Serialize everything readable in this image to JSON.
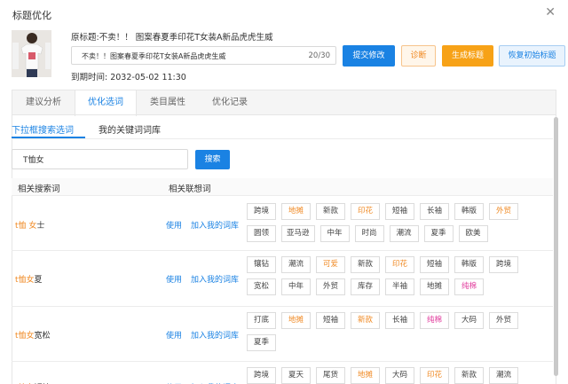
{
  "dialog": {
    "title": "标题优化",
    "close_icon": "close-icon"
  },
  "product": {
    "original_title": "原标题:不卖！！ 图案春夏季印花T女装A新品虎虎生威",
    "title_value": "不卖！！图案春夏季印花T女装A新品虎虎生威",
    "char_count": "20/30",
    "expire": "到期时间: 2032-05-02 11:30"
  },
  "buttons": {
    "submit": "提交修改",
    "diagnose": "诊断",
    "generate": "生成标题",
    "restore": "恢复初始标题"
  },
  "tabs": [
    "建议分析",
    "优化选词",
    "类目属性",
    "优化记录"
  ],
  "subtabs": [
    "下拉框搜索选词",
    "我的关键词词库"
  ],
  "search": {
    "value": "T恤女",
    "button": "搜索"
  },
  "table": {
    "headers": [
      "相关搜索词",
      "相关联想词"
    ],
    "use_label": "使用",
    "add_label": "加入我的词库",
    "rows": [
      {
        "kw_hl": "t恤 女",
        "kw_rest": "士",
        "tags": [
          [
            "跨境",
            ""
          ],
          [
            "地摊",
            "hot"
          ],
          [
            "新款",
            ""
          ],
          [
            "印花",
            "hot"
          ],
          [
            "短袖",
            ""
          ],
          [
            "长袖",
            ""
          ],
          [
            "韩版",
            ""
          ],
          [
            "外贸",
            "hot"
          ],
          [
            "圆领",
            ""
          ],
          [
            "亚马逊",
            ""
          ],
          [
            "中年",
            ""
          ],
          [
            "时尚",
            ""
          ],
          [
            "潮流",
            ""
          ],
          [
            "夏季",
            ""
          ],
          [
            "欧美",
            ""
          ]
        ]
      },
      {
        "kw_hl": "t恤女",
        "kw_rest": "夏",
        "tags": [
          [
            "镶钻",
            ""
          ],
          [
            "潮流",
            ""
          ],
          [
            "可爱",
            "hot"
          ],
          [
            "新款",
            ""
          ],
          [
            "印花",
            "hot"
          ],
          [
            "短袖",
            ""
          ],
          [
            "韩版",
            ""
          ],
          [
            "跨境",
            ""
          ],
          [
            "宽松",
            ""
          ],
          [
            "中年",
            ""
          ],
          [
            "外贸",
            ""
          ],
          [
            "库存",
            ""
          ],
          [
            "半袖",
            ""
          ],
          [
            "地摊",
            ""
          ],
          [
            "纯棉",
            "pk"
          ]
        ]
      },
      {
        "kw_hl": "t恤女",
        "kw_rest": "宽松",
        "tags": [
          [
            "打底",
            ""
          ],
          [
            "地摊",
            "hot"
          ],
          [
            "短袖",
            ""
          ],
          [
            "新款",
            "hot"
          ],
          [
            "长袖",
            ""
          ],
          [
            "纯棉",
            "pk"
          ],
          [
            "大码",
            ""
          ],
          [
            "外贸",
            ""
          ],
          [
            "夏季",
            ""
          ]
        ]
      },
      {
        "kw_hl": "t恤女",
        "kw_rest": "短袖",
        "tags": [
          [
            "跨境",
            ""
          ],
          [
            "夏天",
            ""
          ],
          [
            "尾货",
            ""
          ],
          [
            "地摊",
            "hot"
          ],
          [
            "大码",
            ""
          ],
          [
            "印花",
            "hot"
          ],
          [
            "新款",
            ""
          ],
          [
            "潮流",
            ""
          ]
        ]
      }
    ]
  }
}
